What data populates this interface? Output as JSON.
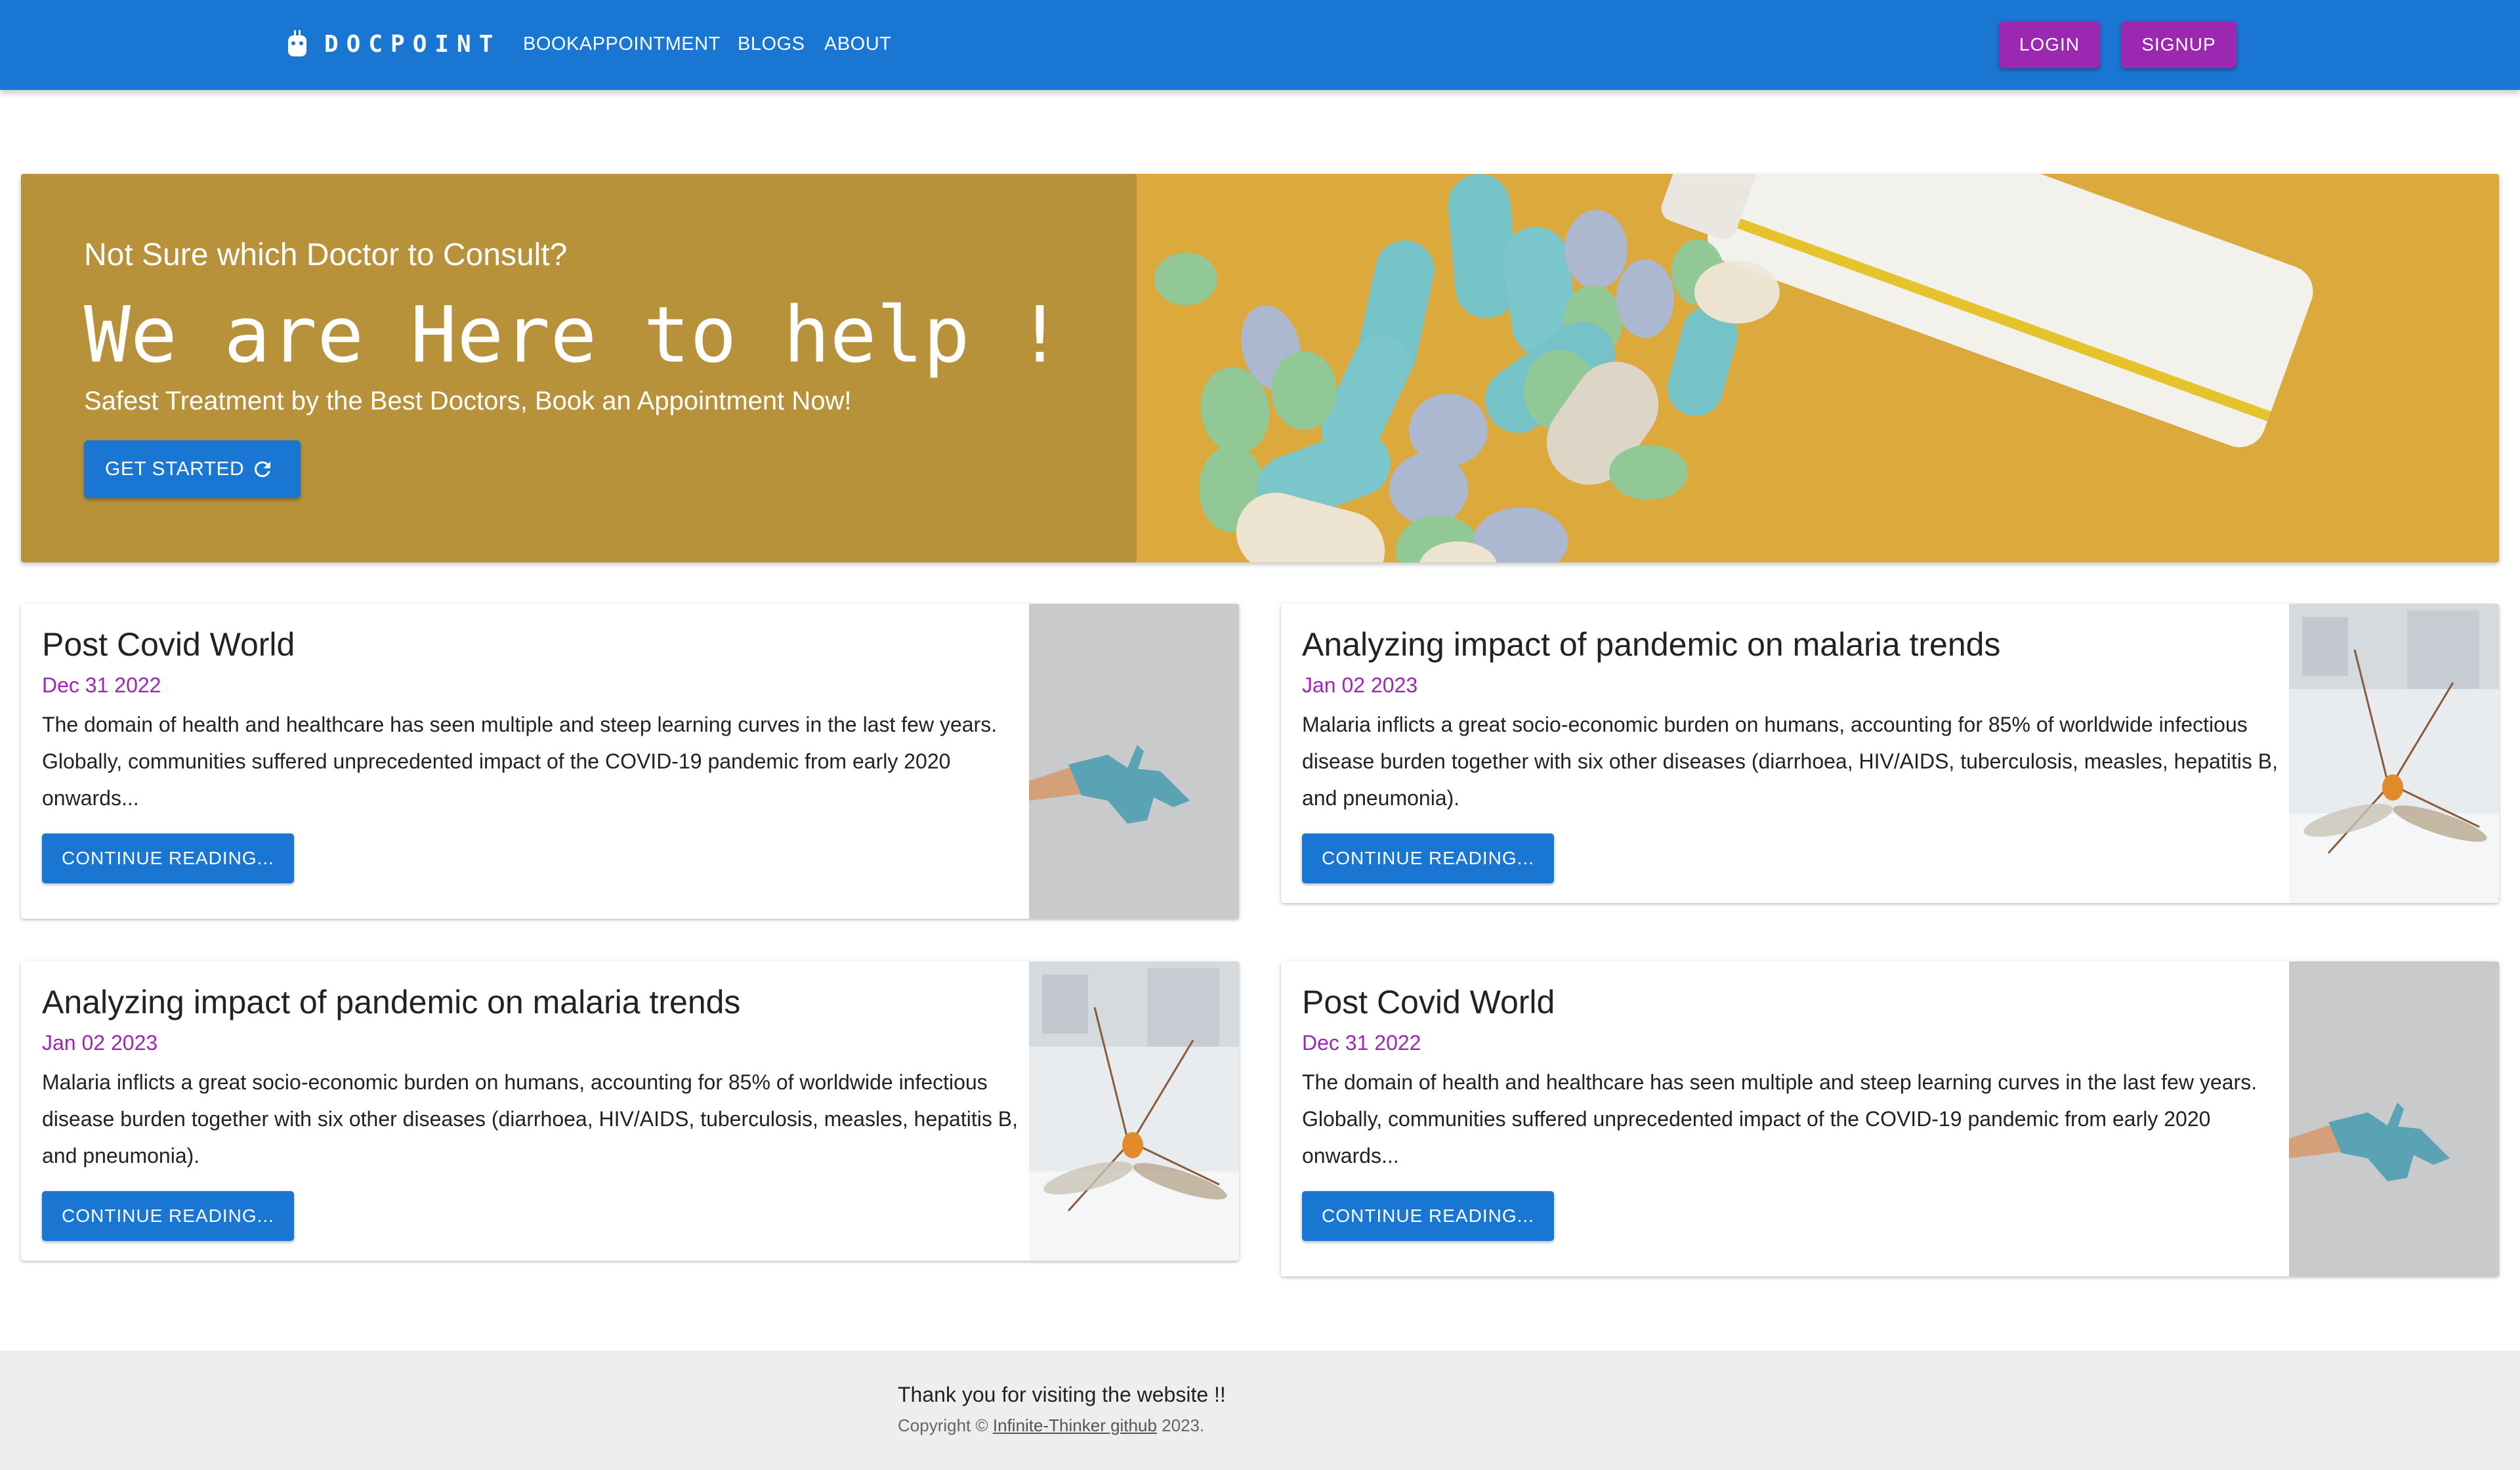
{
  "navbar": {
    "brand": "DOCPOINT",
    "links": [
      "BOOKAPPOINTMENT",
      "BLOGS",
      "ABOUT"
    ],
    "login_label": "LOGIN",
    "signup_label": "SIGNUP"
  },
  "hero": {
    "subtitle": "Not Sure which Doctor to Consult?",
    "title": "We are Here to help !",
    "tagline": "Safest Treatment by the Best Doctors, Book an Appointment Now!",
    "cta_label": "GET STARTED"
  },
  "posts": [
    {
      "title": "Post Covid World",
      "date": "Dec 31 2022",
      "excerpt": "The domain of health and healthcare has seen multiple and steep learning curves in the last few years. Globally, communities suffered unprecedented impact of the COVID-19 pandemic from early 2020 onwards...",
      "button_label": "CONTINUE READING...",
      "image": "gloved-hand-photo"
    },
    {
      "title": "Analyzing impact of pandemic on malaria trends",
      "date": "Jan 02 2023",
      "excerpt": "Malaria inflicts a great socio-economic burden on humans, accounting for 85% of worldwide infectious disease burden together with six other diseases (diarrhoea, HIV/AIDS, tuberculosis, measles, hepatitis B, and pneumonia).",
      "button_label": "CONTINUE READING...",
      "image": "mosquito-photo"
    },
    {
      "title": "Analyzing impact of pandemic on malaria trends",
      "date": "Jan 02 2023",
      "excerpt": "Malaria inflicts a great socio-economic burden on humans, accounting for 85% of worldwide infectious disease burden together with six other diseases (diarrhoea, HIV/AIDS, tuberculosis, measles, hepatitis B, and pneumonia).",
      "button_label": "CONTINUE READING...",
      "image": "mosquito-photo"
    },
    {
      "title": "Post Covid World",
      "date": "Dec 31 2022",
      "excerpt": "The domain of health and healthcare has seen multiple and steep learning curves in the last few years. Globally, communities suffered unprecedented impact of the COVID-19 pandemic from early 2020 onwards...",
      "button_label": "CONTINUE READING...",
      "image": "gloved-hand-photo"
    }
  ],
  "footer": {
    "thanks": "Thank you for visiting the website !!",
    "copyright_prefix": "Copyright ©",
    "link_text": "Infinite-Thinker github",
    "copyright_suffix": "2023."
  },
  "colors": {
    "primary": "#1976d2",
    "secondary": "#9c27b0",
    "hero_bg": "#b8913b",
    "footer_bg": "#eeeeee"
  },
  "icons": [
    "robot-logo-icon",
    "refresh-icon"
  ]
}
